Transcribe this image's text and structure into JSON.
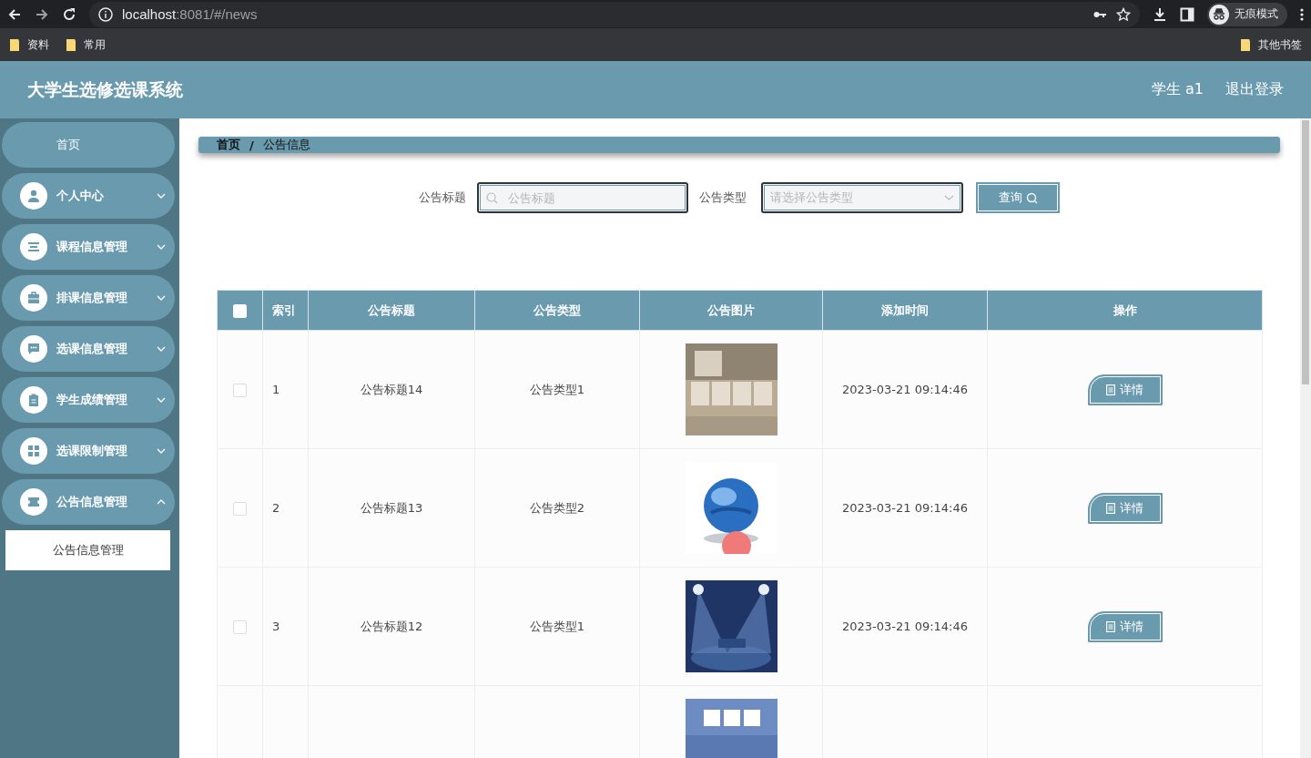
{
  "browser": {
    "url_host": "localhost",
    "url_rest": ":8081/#/news",
    "bookmarks": [
      "资料",
      "常用"
    ],
    "other_bookmarks": "其他书签",
    "profile": "无痕模式"
  },
  "header": {
    "title": "大学生选修选课系统",
    "user": "学生 a1",
    "logout": "退出登录"
  },
  "sidebar": {
    "items": [
      {
        "kind": "link",
        "label": "首页"
      },
      {
        "kind": "menu",
        "label": "个人中心",
        "expanded": false
      },
      {
        "kind": "menu",
        "label": "课程信息管理",
        "expanded": false
      },
      {
        "kind": "menu",
        "label": "排课信息管理",
        "expanded": false
      },
      {
        "kind": "menu",
        "label": "选课信息管理",
        "expanded": false
      },
      {
        "kind": "menu",
        "label": "学生成绩管理",
        "expanded": false
      },
      {
        "kind": "menu",
        "label": "选课限制管理",
        "expanded": false
      },
      {
        "kind": "menu",
        "label": "公告信息管理",
        "expanded": true,
        "children": [
          {
            "label": "公告信息管理",
            "selected": true
          }
        ]
      }
    ]
  },
  "breadcrumb": {
    "items": [
      "首页",
      "公告信息"
    ],
    "separator": "/"
  },
  "search": {
    "title_label": "公告标题",
    "title_placeholder": "公告标题",
    "type_label": "公告类型",
    "type_placeholder": "请选择公告类型",
    "button": "查询"
  },
  "table": {
    "columns": [
      "索引",
      "公告标题",
      "公告类型",
      "公告图片",
      "添加时间",
      "操作"
    ],
    "header_checked": false,
    "rows": [
      {
        "checked": false,
        "index": "1",
        "title": "公告标题14",
        "type": "公告类型1",
        "image": {
          "kind": "picture"
        },
        "time": "2023-03-21 09:14:46",
        "action": "详情"
      },
      {
        "checked": false,
        "index": "2",
        "title": "公告标题13",
        "type": "公告类型2",
        "image": {
          "kind": "picture"
        },
        "time": "2023-03-21 09:14:46",
        "action": "详情"
      },
      {
        "checked": false,
        "index": "3",
        "title": "公告标题12",
        "type": "公告类型1",
        "image": {
          "kind": "picture"
        },
        "time": "2023-03-21 09:14:46",
        "action": "详情"
      },
      {
        "image": {
          "kind": "picture"
        }
      }
    ]
  }
}
